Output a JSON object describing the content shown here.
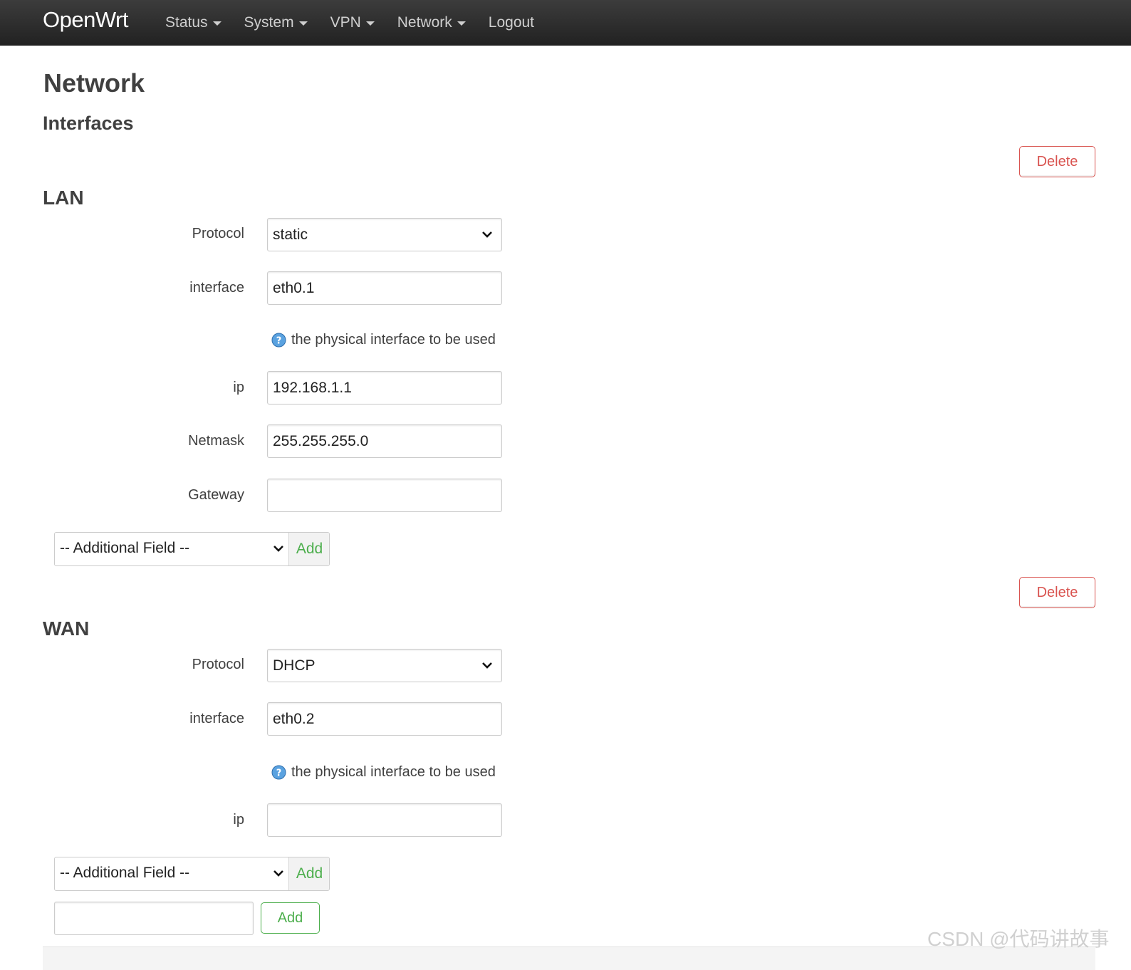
{
  "navbar": {
    "brand": "OpenWrt",
    "menu": [
      {
        "label": "Status",
        "dropdown": true
      },
      {
        "label": "System",
        "dropdown": true
      },
      {
        "label": "VPN",
        "dropdown": true
      },
      {
        "label": "Network",
        "dropdown": true
      },
      {
        "label": "Logout",
        "dropdown": false
      }
    ]
  },
  "page": {
    "title": "Network",
    "subtitle": "Interfaces"
  },
  "sections": [
    {
      "name": "LAN",
      "delete_label": "Delete",
      "fields": {
        "protocol": {
          "label": "Protocol",
          "value": "static"
        },
        "interface": {
          "label": "interface",
          "value": "eth0.1",
          "help": "the physical interface to be used"
        },
        "ip": {
          "label": "ip",
          "value": "192.168.1.1"
        },
        "netmask": {
          "label": "Netmask",
          "value": "255.255.255.0"
        },
        "gateway": {
          "label": "Gateway",
          "value": ""
        }
      },
      "additional_field": {
        "selected": "-- Additional Field --",
        "add_label": "Add"
      }
    },
    {
      "name": "WAN",
      "delete_label": "Delete",
      "fields": {
        "protocol": {
          "label": "Protocol",
          "value": "DHCP"
        },
        "interface": {
          "label": "interface",
          "value": "eth0.2",
          "help": "the physical interface to be used"
        },
        "ip": {
          "label": "ip",
          "value": ""
        }
      },
      "additional_field": {
        "selected": "-- Additional Field --",
        "add_label": "Add"
      }
    }
  ],
  "new_section": {
    "input_value": "",
    "add_label": "Add"
  },
  "watermark": "CSDN @代码讲故事",
  "colors": {
    "navbar_bg": "#222222",
    "danger": "#d9534f",
    "success": "#4cae4c",
    "help_icon": "#3b82c4"
  }
}
